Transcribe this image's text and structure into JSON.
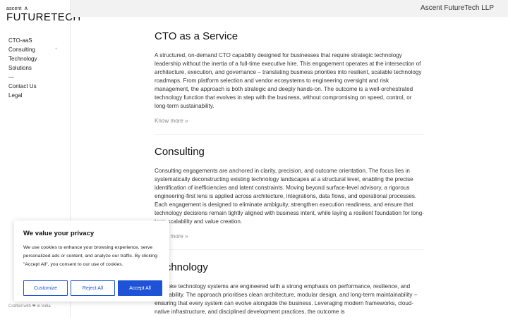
{
  "brand": {
    "top": "ascent",
    "mark": "Λ",
    "main": "FUTURETECH"
  },
  "header": {
    "company": "Ascent FutureTech LLP"
  },
  "sidebar": {
    "items": [
      {
        "label": "CTO-aaS"
      },
      {
        "label": "Consulting",
        "chevron": "+"
      },
      {
        "label": "Technology"
      },
      {
        "label": "Solutions"
      },
      {
        "label": "—"
      },
      {
        "label": "Contact Us"
      },
      {
        "label": "Legal"
      }
    ],
    "crafted": "Crafted with ❤ in India"
  },
  "sections": [
    {
      "title": "CTO as a Service",
      "body": "A structured, on-demand CTO capability designed for businesses that require strategic technology leadership without the inertia of a full-time executive hire. This engagement operates at the intersection of architecture, execution, and governance – translating business priorities into resilient, scalable technology roadmaps. From platform selection and vendor ecosystems to engineering oversight and risk management, the approach is both strategic and deeply hands-on. The outcome is a well-orchestrated technology function that evolves in step with the business, without compromising on speed, control, or long-term sustainability.",
      "more": "Know more »"
    },
    {
      "title": "Consulting",
      "body": "Consulting engagements are anchored in clarity, precision, and outcome orientation. The focus lies in systematically deconstructing existing technology landscapes at a structural level, enabling the precise identification of inefficiencies and latent constraints. Moving beyond surface-level advisory, a rigorous engineering-first lens is applied across architecture, integrations, data flows, and operational processes. Each engagement is designed to eliminate ambiguity, strengthen execution readiness, and ensure that technology decisions remain tightly aligned with business intent, while laying a resilient foundation for long-term scalability and value creation.",
      "more": "Know more »"
    },
    {
      "title": "Technology",
      "body": "Bespoke technology systems are engineered with a strong emphasis on performance, resilience, and adaptability. The approach prioritises clean architecture, modular design, and long-term maintainability – ensuring that every system can evolve alongside the business. Leveraging modern frameworks, cloud-native infrastructure, and disciplined development practices, the outcome is",
      "more": ""
    }
  ],
  "cookie": {
    "title": "We value your privacy",
    "text": "We use cookies to enhance your browsing experience, serve personalized ads or content, and analyze our traffic. By clicking \"Accept All\", you consent to our use of cookies.",
    "customize": "Customize",
    "reject": "Reject All",
    "accept": "Accept All"
  },
  "colors": {
    "accent": "#1e53d8",
    "header_bg": "#f2f2f2"
  }
}
